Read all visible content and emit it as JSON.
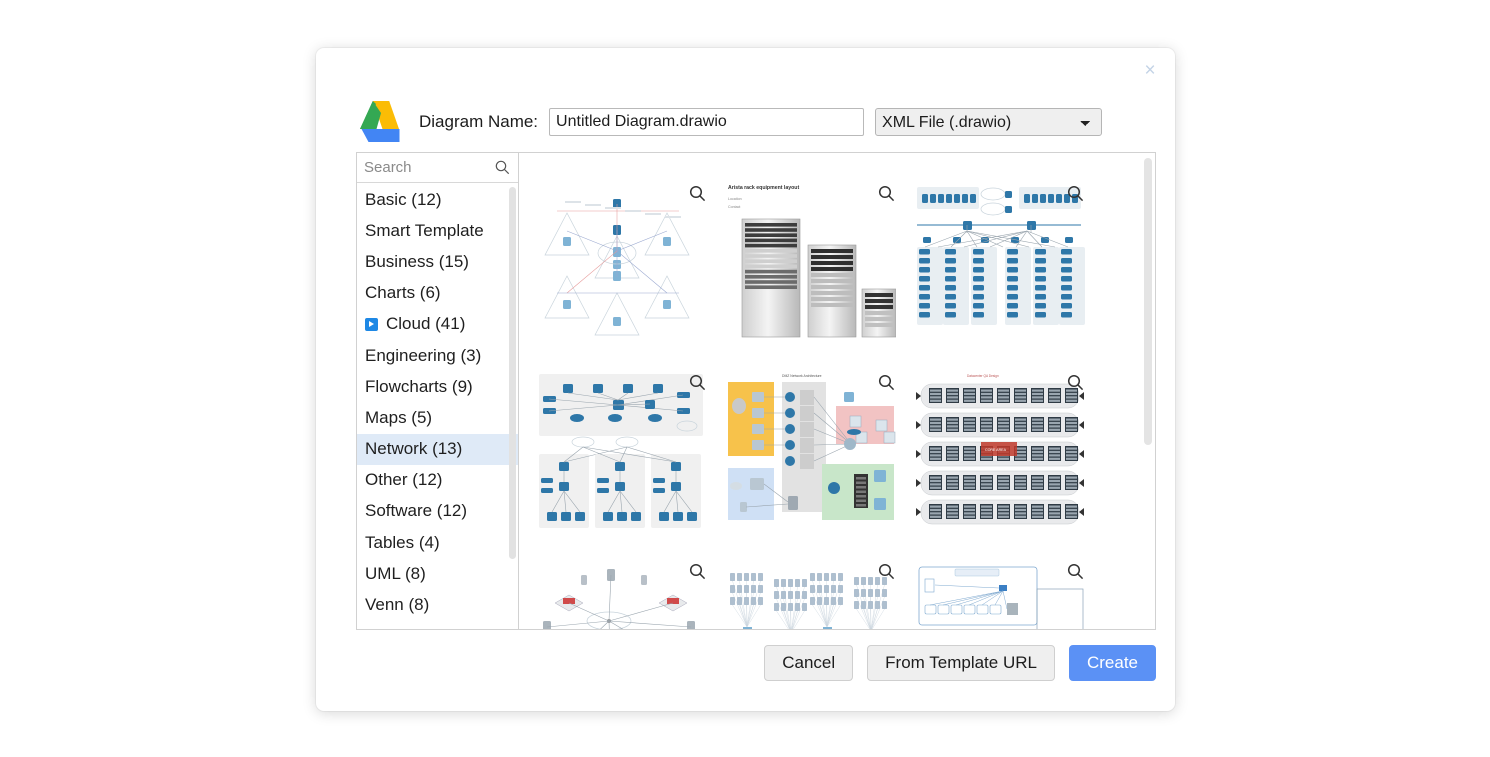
{
  "dialog": {
    "close_label": "×"
  },
  "header": {
    "logo_name": "google-drive-logo",
    "diagram_name_label": "Diagram Name:",
    "diagram_name_value": "Untitled Diagram.drawio",
    "file_type_selected": "XML File (.drawio)",
    "file_type_options": [
      "XML File (.drawio)"
    ]
  },
  "sidebar": {
    "search_placeholder": "Search",
    "search_value": "",
    "items": [
      {
        "label": "Basic (12)",
        "selected": false,
        "expandable": false
      },
      {
        "label": "Smart Template",
        "selected": false,
        "expandable": false
      },
      {
        "label": "Business (15)",
        "selected": false,
        "expandable": false
      },
      {
        "label": "Charts (6)",
        "selected": false,
        "expandable": false
      },
      {
        "label": "Cloud (41)",
        "selected": false,
        "expandable": true
      },
      {
        "label": "Engineering (3)",
        "selected": false,
        "expandable": false
      },
      {
        "label": "Flowcharts (9)",
        "selected": false,
        "expandable": false
      },
      {
        "label": "Maps (5)",
        "selected": false,
        "expandable": false
      },
      {
        "label": "Network (13)",
        "selected": true,
        "expandable": false
      },
      {
        "label": "Other (12)",
        "selected": false,
        "expandable": false
      },
      {
        "label": "Software (12)",
        "selected": false,
        "expandable": false
      },
      {
        "label": "Tables (4)",
        "selected": false,
        "expandable": false
      },
      {
        "label": "UML (8)",
        "selected": false,
        "expandable": false
      },
      {
        "label": "Venn (8)",
        "selected": false,
        "expandable": false
      }
    ]
  },
  "templates": {
    "zoom_icon_name": "zoom-preview-icon",
    "items": [
      {
        "style": "hub-spoke-triangles",
        "caption": ""
      },
      {
        "style": "rack-equipment",
        "caption": "Arista rack equipment layout"
      },
      {
        "style": "switch-tree-wide",
        "caption": ""
      },
      {
        "style": "campus-network",
        "caption": ""
      },
      {
        "style": "zoned-architecture",
        "caption": ""
      },
      {
        "style": "dense-rack-rows",
        "caption": ""
      },
      {
        "style": "small-office-net",
        "caption": ""
      },
      {
        "style": "device-clusters",
        "caption": ""
      },
      {
        "style": "boxed-topology",
        "caption": ""
      }
    ]
  },
  "footer": {
    "cancel_label": "Cancel",
    "template_url_label": "From Template URL",
    "create_label": "Create"
  },
  "colors": {
    "primary": "#5b91f5",
    "selected_row": "#dfeaf7",
    "accent_blue": "#1e88e5",
    "node_blue": "#2e77a8",
    "zone_yellow": "#f7c24b",
    "zone_pink": "#f2c3c3",
    "zone_green": "#c8e6c9",
    "zone_blue": "#cfe0f5"
  }
}
